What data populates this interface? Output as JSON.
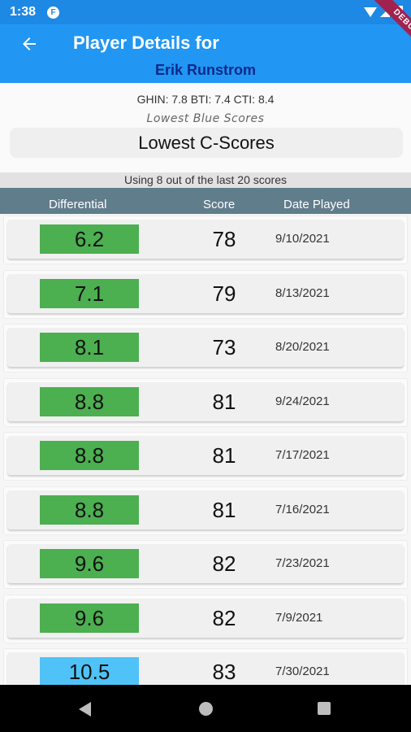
{
  "status": {
    "time": "1:38",
    "app_icon": "F"
  },
  "debug_banner": "DEBUG",
  "app_bar": {
    "title": "Player Details for",
    "player_name": "Erik Runstrom"
  },
  "info": {
    "handicaps": "GHIN: 7.8 BTI: 7.4 CTI: 8.4",
    "subtitle": "Lowest Blue Scores",
    "score_type_button": "Lowest C-Scores"
  },
  "using_text": "Using 8 out of the last 20 scores",
  "columns": {
    "differential": "Differential",
    "score": "Score",
    "date": "Date Played"
  },
  "colors": {
    "used": "#4caf50",
    "unused": "#4fc3f7",
    "header": "#607d8b",
    "app_bar": "#2196f3"
  },
  "scores": [
    {
      "differential": "6.2",
      "score": "78",
      "date": "9/10/2021",
      "used": true
    },
    {
      "differential": "7.1",
      "score": "79",
      "date": "8/13/2021",
      "used": true
    },
    {
      "differential": "8.1",
      "score": "73",
      "date": "8/20/2021",
      "used": true
    },
    {
      "differential": "8.8",
      "score": "81",
      "date": "9/24/2021",
      "used": true
    },
    {
      "differential": "8.8",
      "score": "81",
      "date": "7/17/2021",
      "used": true
    },
    {
      "differential": "8.8",
      "score": "81",
      "date": "7/16/2021",
      "used": true
    },
    {
      "differential": "9.6",
      "score": "82",
      "date": "7/23/2021",
      "used": true
    },
    {
      "differential": "9.6",
      "score": "82",
      "date": "7/9/2021",
      "used": true
    },
    {
      "differential": "10.5",
      "score": "83",
      "date": "7/30/2021",
      "used": false
    }
  ],
  "nav_icons": [
    "back-triangle-icon",
    "home-circle-icon",
    "recents-square-icon"
  ]
}
